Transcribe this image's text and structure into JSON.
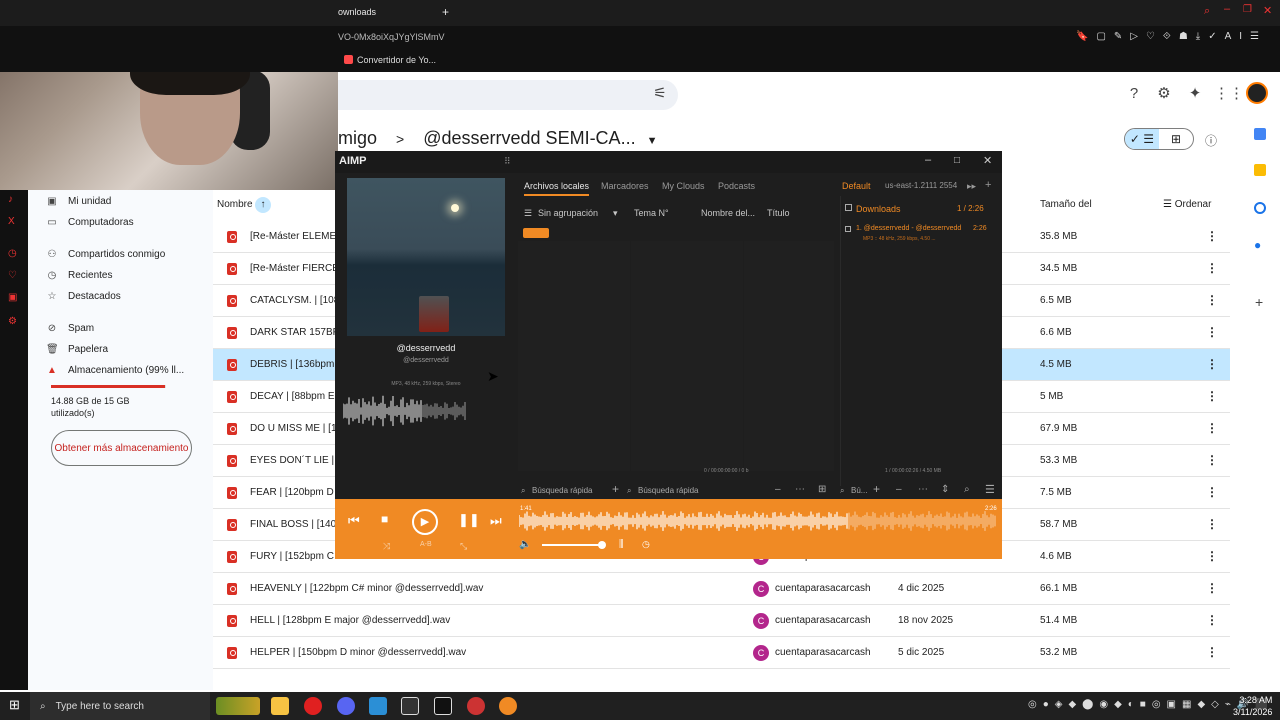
{
  "browser": {
    "tab_title": "ownloads",
    "url_fragment": "VO-0Mx8oiXqJYgYlSMmV",
    "bookmark": "Convertidor de Yo..."
  },
  "drive": {
    "breadcrumb_prefix": "migo",
    "breadcrumb_sep": ">",
    "folder": "@desserrvedd SEMI-CA...",
    "nav": [
      {
        "label": "Mi unidad",
        "icon": "drive-icon"
      },
      {
        "label": "Computadoras",
        "icon": "computer-icon"
      },
      {
        "label": "Compartidos conmigo",
        "icon": "people-icon"
      },
      {
        "label": "Recientes",
        "icon": "clock-icon"
      },
      {
        "label": "Destacados",
        "icon": "star-icon"
      },
      {
        "label": "Spam",
        "icon": "spam-icon"
      },
      {
        "label": "Papelera",
        "icon": "trash-icon"
      },
      {
        "label": "Almacenamiento (99% ll...",
        "icon": "warning-icon"
      }
    ],
    "storage_text": "14.88 GB de 15 GB utilizado(s)",
    "storage_percent": 99,
    "get_storage": "Obtener más almacenamiento",
    "columns": {
      "name": "Nombre",
      "size": "Tamaño del",
      "sort": "Ordenar"
    },
    "rows": [
      {
        "name": "[Re-Máster ELEME",
        "owner": "",
        "date": "",
        "size": "35.8 MB"
      },
      {
        "name": "[Re-Máster FIERCE",
        "owner": "",
        "date": "",
        "size": "34.5 MB"
      },
      {
        "name": "CATACLYSM. | [108",
        "owner": "",
        "date": "",
        "size": "6.5 MB"
      },
      {
        "name": "DARK STAR 157BPM",
        "owner": "",
        "date": "",
        "size": "6.6 MB"
      },
      {
        "name": "DEBRIS | [136bpm E",
        "owner": "",
        "date": "",
        "size": "4.5 MB",
        "selected": true
      },
      {
        "name": "DECAY | [88bpm E",
        "owner": "",
        "date": "",
        "size": "5 MB"
      },
      {
        "name": "DO U MISS ME | [16",
        "owner": "",
        "date": "",
        "size": "67.9 MB"
      },
      {
        "name": "EYES DON´T LIE | [",
        "owner": "",
        "date": "",
        "size": "53.3 MB"
      },
      {
        "name": "FEAR | [120bpm D",
        "owner": "",
        "date": "",
        "size": "7.5 MB"
      },
      {
        "name": "FINAL BOSS | [140",
        "owner": "",
        "date": "",
        "size": "58.7 MB"
      },
      {
        "name": "FURY | [152bpm C",
        "owner": "cuentaparasacarcash",
        "date": "",
        "size": "4.6 MB"
      },
      {
        "name": "HEAVENLY | [122bpm C# minor @desserrvedd].wav",
        "owner": "cuentaparasacarcash",
        "date": "4 dic 2025",
        "size": "66.1 MB"
      },
      {
        "name": "HELL | [128bpm E major @desserrvedd].wav",
        "owner": "cuentaparasacarcash",
        "date": "18 nov 2025",
        "size": "51.4 MB"
      },
      {
        "name": "HELPER | [150bpm D minor @desserrvedd].wav",
        "owner": "cuentaparasacarcash",
        "date": "5 dic 2025",
        "size": "53.2 MB"
      }
    ]
  },
  "aimp": {
    "logo": "AIMP",
    "artist": "@desserrvedd",
    "album": "@desserrvedd",
    "format": "MP3, 48 kHz, 259 kbps, Stereo",
    "tabs": [
      "Archivos locales",
      "Marcadores",
      "My Clouds",
      "Podcasts"
    ],
    "playlist_cols": [
      "Sin agrupación",
      "Tema N°",
      "Nombre del...",
      "Título"
    ],
    "right_tabs": [
      "Default",
      "us-east-1.2111 2554"
    ],
    "group": "Downloads",
    "group_count": "1 / 2:26",
    "track_line": "1. @desserrvedd - @desserrvedd",
    "track_time": "2:26",
    "track_info": "MP3 :: 48 kHz, 259 kbps, 4.50 ...",
    "status_left": "0 / 00:00:00:00 / 0 b",
    "status_right": "1 / 00:00:02:26 / 4.50 MB",
    "search_1": "Búsqueda rápida",
    "search_2": "Búsqueda rápida",
    "search_3": "Bú...",
    "pos": "1:41",
    "duration": "2:26",
    "progress": 0.69,
    "volume": 1.0
  },
  "taskbar": {
    "search": "Type here to search",
    "time": "3:28 AM",
    "date": "3/11/2026"
  }
}
